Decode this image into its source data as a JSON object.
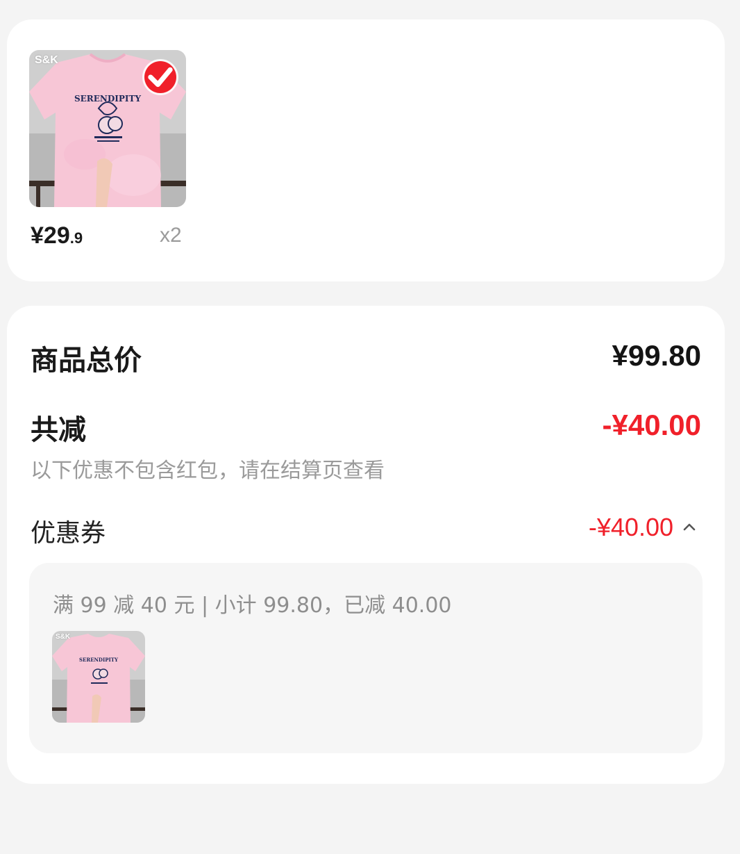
{
  "product": {
    "brand_logo": "S&K",
    "print_text": "SERENDIPITY",
    "selected": true,
    "price_currency": "¥",
    "price_int": "29",
    "price_dec": ".9",
    "quantity": "x2"
  },
  "summary": {
    "total_label": "商品总价",
    "total_value": "¥99.80",
    "reduce_label": "共减",
    "reduce_value": "-¥40.00",
    "reduce_note": "以下优惠不包含红包，请在结算页查看",
    "coupon_label": "优惠券",
    "coupon_value": "-¥40.00",
    "coupon_expand_icon": "chevron-up-icon"
  },
  "coupon_detail": {
    "description": "满 99 减 40 元 | 小计 99.80，已减 40.00",
    "item_brand_logo": "S&K",
    "item_print_text": "SERENDIPITY"
  },
  "colors": {
    "accent_red": "#f0202a",
    "background": "#f4f4f4",
    "card": "#ffffff"
  }
}
